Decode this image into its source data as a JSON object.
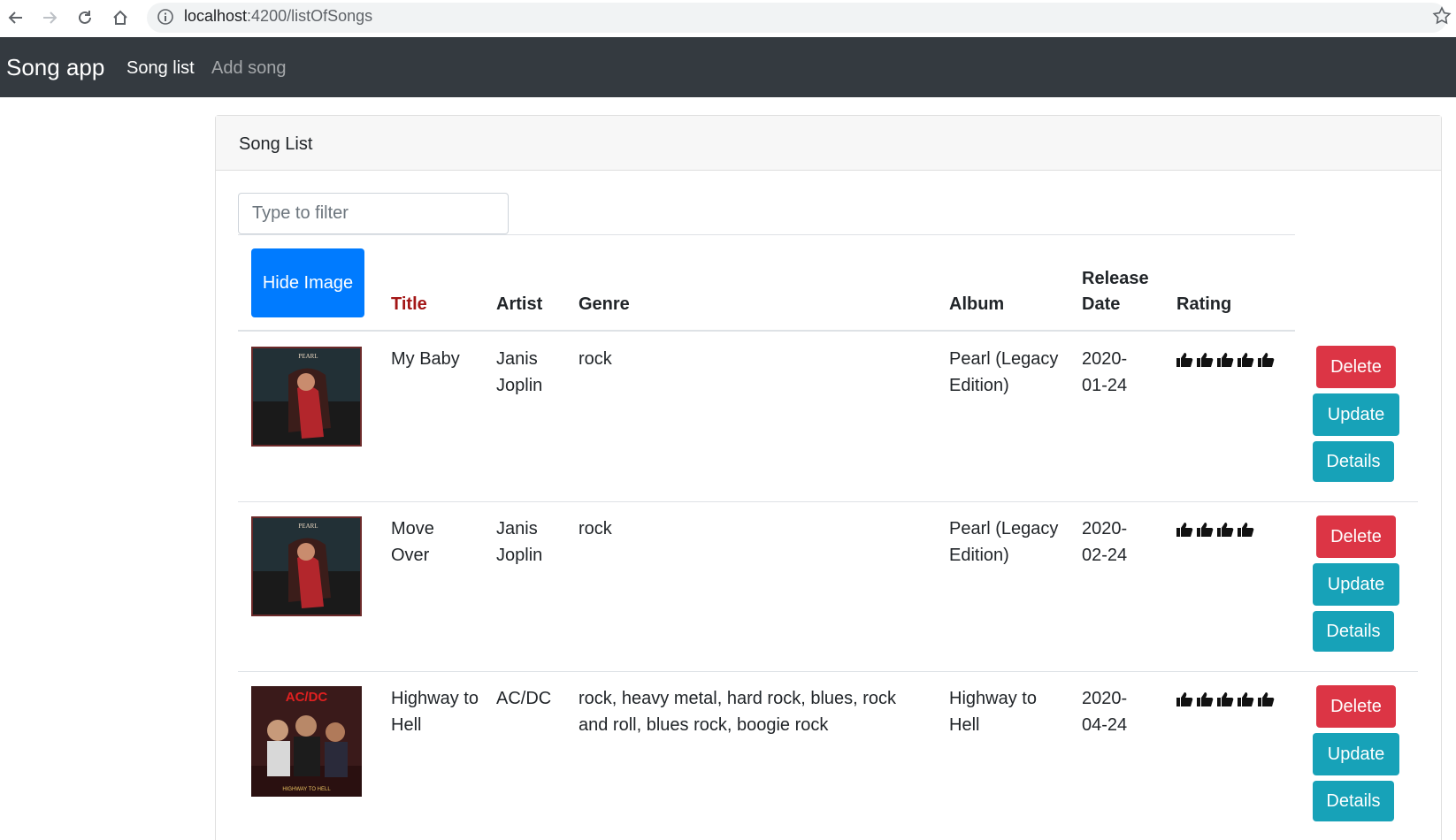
{
  "browser": {
    "url_host": "localhost",
    "url_path": ":4200/listOfSongs"
  },
  "navbar": {
    "brand": "Song app",
    "links": [
      {
        "label": "Song list",
        "active": true
      },
      {
        "label": "Add song",
        "active": false
      }
    ]
  },
  "card": {
    "header": "Song List",
    "filter_placeholder": "Type to filter"
  },
  "table": {
    "toggle_image_button": "Hide Image",
    "headers": {
      "title": "Title",
      "artist": "Artist",
      "genre": "Genre",
      "album": "Album",
      "release_date_line1": "Release",
      "release_date_line2": "Date",
      "rating": "Rating"
    },
    "rows": [
      {
        "title": "My Baby",
        "artist": "Janis Joplin",
        "genre": "rock",
        "album": "Pearl (Legacy Edition)",
        "release_date": "2020-01-24",
        "rating": 5,
        "cover": "pearl"
      },
      {
        "title": "Move Over",
        "artist": "Janis Joplin",
        "genre": "rock",
        "album": "Pearl (Legacy Edition)",
        "release_date": "2020-02-24",
        "rating": 4,
        "cover": "pearl"
      },
      {
        "title": "Highway to Hell",
        "artist": "AC/DC",
        "genre": "rock, heavy metal, hard rock, blues, rock and roll, blues rock, boogie rock",
        "album": "Highway to Hell",
        "release_date": "2020-04-24",
        "rating": 5,
        "cover": "acdc"
      }
    ],
    "actions": {
      "delete": "Delete",
      "update": "Update",
      "details": "Details"
    },
    "cover_text": {
      "pearl": "PEARL",
      "acdc_logo": "AC/DC",
      "acdc_album": "HIGHWAY TO HELL"
    }
  },
  "colors": {
    "navbar_bg": "#343a40",
    "primary": "#007bff",
    "danger": "#dc3545",
    "info": "#17a2b8",
    "sortable_header": "#a31616"
  }
}
